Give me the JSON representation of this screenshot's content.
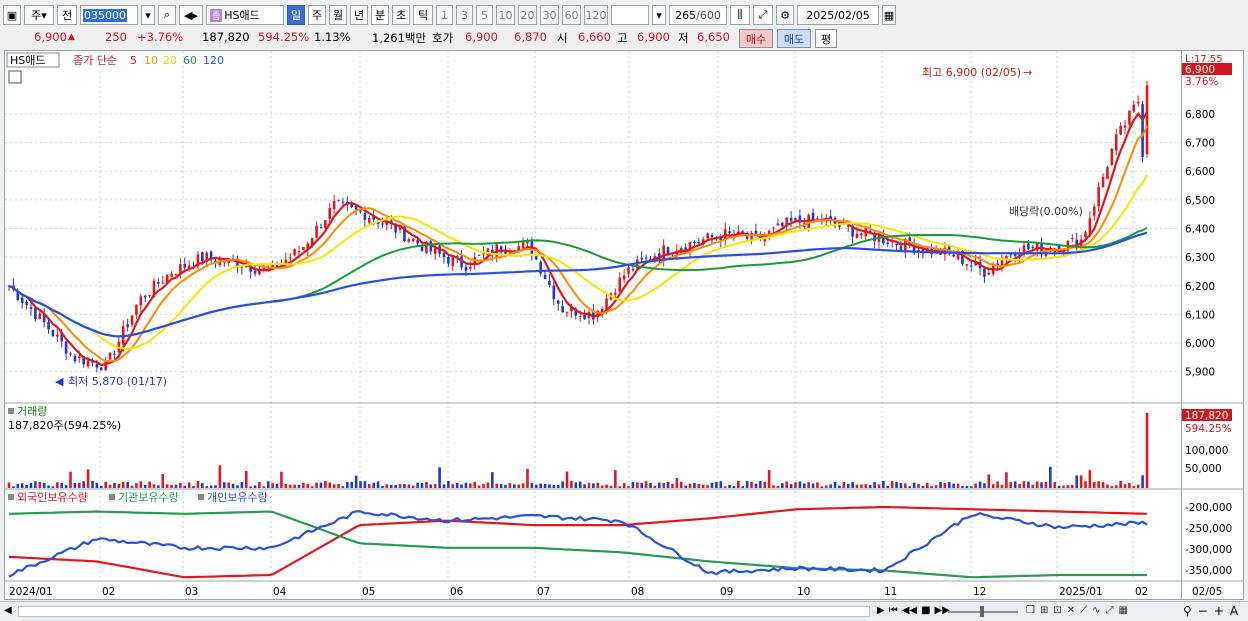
{
  "toolbar": {
    "market": "주",
    "prefix": "전",
    "stock_code": "035000",
    "stock_name": "HS애드",
    "stock_badge": "종",
    "periods": [
      "일",
      "주",
      "월",
      "년",
      "분",
      "초",
      "틱"
    ],
    "intervals": [
      "1",
      "3",
      "5",
      "10",
      "20",
      "30",
      "60",
      "120"
    ],
    "count": "265",
    "count_total": "/600",
    "date": "2025/02/05"
  },
  "quote": {
    "price": "6,900",
    "change": "250",
    "change_pct": "+3.76%",
    "volume": "187,820",
    "volume_ratio": "594.25%",
    "turnover": "1.13%",
    "amount": "1,261백만",
    "ask_label": "호가",
    "ask": "6,900",
    "bid": "6,870",
    "open_label": "시",
    "open": "6,660",
    "high_label": "고",
    "high": "6,900",
    "low_label": "저",
    "low": "6,650",
    "buy_label": "매수",
    "sell_label": "매도",
    "eval_label": "평"
  },
  "legend": {
    "name": "HS애드",
    "indicator": "종가 단순",
    "ma": [
      "5",
      "10",
      "20",
      "60",
      "120"
    ]
  },
  "annotations": {
    "high": "최고 6,900 (02/05)",
    "low": "최저 5,870 (01/17)",
    "dividend": "배당락(0.00%)"
  },
  "price_axis": {
    "top_label": "L:17.55",
    "current": "6,900",
    "current_pct": "3.76%",
    "ticks": [
      "6,800",
      "6,700",
      "6,600",
      "6,500",
      "6,400",
      "6,300",
      "6,200",
      "6,100",
      "6,000",
      "5,900"
    ]
  },
  "volume_panel": {
    "title": "거래량",
    "summary": "187,820주(594.25%)",
    "current": "187,820",
    "current_pct": "594.25%",
    "ticks": [
      "100,000",
      "50,000"
    ]
  },
  "holdings_panel": {
    "series": [
      "외국인보유수량",
      "기관보유수량",
      "개인보유수량"
    ],
    "ticks": [
      "-200,000",
      "-250,000",
      "-300,000",
      "-350,000"
    ]
  },
  "x_axis": {
    "labels": [
      "2024/01",
      "02",
      "03",
      "04",
      "05",
      "06",
      "07",
      "08",
      "09",
      "10",
      "11",
      "12",
      "2025/01",
      "02"
    ],
    "end_label": "02/05"
  },
  "colors": {
    "up": "#e0181e",
    "down": "#1a3ad8",
    "ma5": "#e0181e",
    "ma10": "#ff8a00",
    "ma20": "#f5e600",
    "ma60": "#1a9a3a",
    "ma120": "#2a4fe0",
    "foreign": "#e0181e",
    "institution": "#2a9a50",
    "individual": "#2a50e0"
  },
  "chart_data": {
    "type": "candlestick",
    "x": [
      "2024/01",
      "02",
      "03",
      "04",
      "05",
      "06",
      "07",
      "08",
      "09",
      "10",
      "11",
      "12",
      "2025/01",
      "02"
    ],
    "close_approx": [
      6200,
      5950,
      6250,
      6330,
      6420,
      6390,
      6340,
      6180,
      6350,
      6380,
      6430,
      6310,
      6330,
      6900
    ],
    "high": 6900,
    "low": 5870,
    "ylim": [
      5850,
      6950
    ],
    "volume_last": 187820,
    "holdings": {
      "foreign": [
        -310000,
        -320000,
        -355000,
        -350000,
        -240000,
        -230000,
        -240000,
        -240000,
        -225000,
        -205000,
        -200000,
        -205000,
        -210000,
        -215000
      ],
      "institution": [
        -215000,
        -210000,
        -215000,
        -210000,
        -280000,
        -290000,
        -290000,
        -300000,
        -320000,
        -335000,
        -340000,
        -355000,
        -350000,
        -350000
      ],
      "individual": [
        -350000,
        -270000,
        -290000,
        -290000,
        -210000,
        -230000,
        -220000,
        -230000,
        -345000,
        -335000,
        -340000,
        -215000,
        -245000,
        -235000
      ]
    }
  }
}
